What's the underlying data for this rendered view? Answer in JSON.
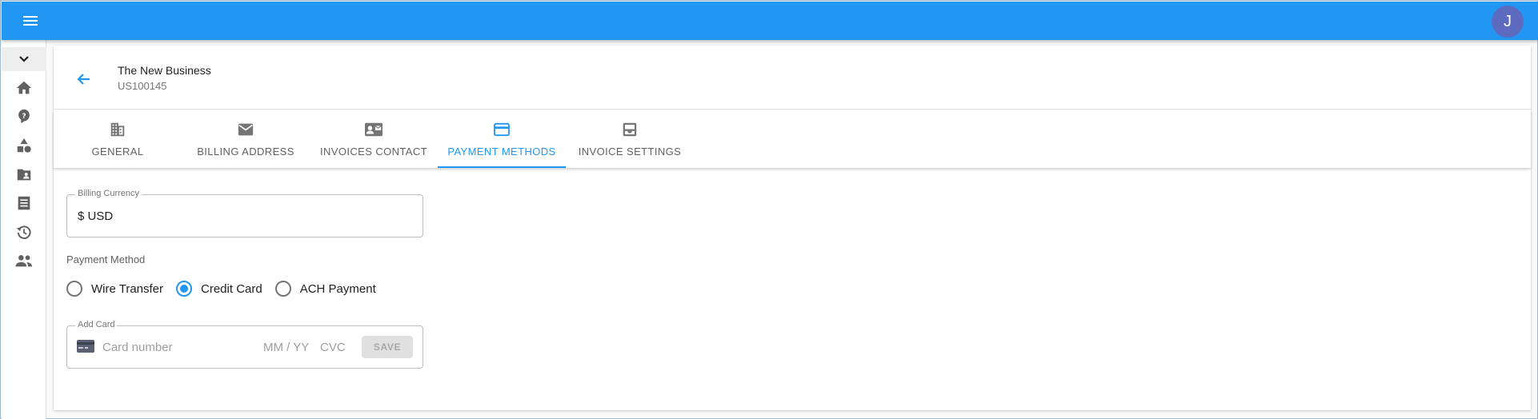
{
  "app": {
    "user_initial": "J",
    "accent_color": "#2196f3"
  },
  "sidebar": {
    "items": [
      {
        "name": "home",
        "icon": "home-icon"
      },
      {
        "name": "help",
        "icon": "help-icon"
      },
      {
        "name": "shapes",
        "icon": "shapes-icon"
      },
      {
        "name": "accounts",
        "icon": "folder-account-icon"
      },
      {
        "name": "invoices",
        "icon": "receipt-icon"
      },
      {
        "name": "history",
        "icon": "history-icon"
      },
      {
        "name": "users",
        "icon": "people-icon"
      }
    ]
  },
  "header": {
    "company_name": "The New Business",
    "company_id": "US100145"
  },
  "tabs": [
    {
      "label": "General",
      "icon": "building-icon",
      "active": false
    },
    {
      "label": "Billing Address",
      "icon": "mail-icon",
      "active": false
    },
    {
      "label": "Invoices Contact",
      "icon": "contact-card-icon",
      "active": false
    },
    {
      "label": "Payment Methods",
      "icon": "credit-card-icon",
      "active": true
    },
    {
      "label": "Invoice Settings",
      "icon": "inbox-icon",
      "active": false
    }
  ],
  "form": {
    "currency": {
      "label": "Billing Currency",
      "value": "$ USD"
    },
    "payment_method": {
      "label": "Payment Method",
      "options": [
        "Wire Transfer",
        "Credit Card",
        "ACH Payment"
      ],
      "selected": "Credit Card"
    },
    "add_card": {
      "label": "Add Card",
      "card_placeholder": "Card number",
      "expiry_placeholder": "MM / YY",
      "cvc_placeholder": "CVC",
      "save_label": "SAVE"
    }
  }
}
